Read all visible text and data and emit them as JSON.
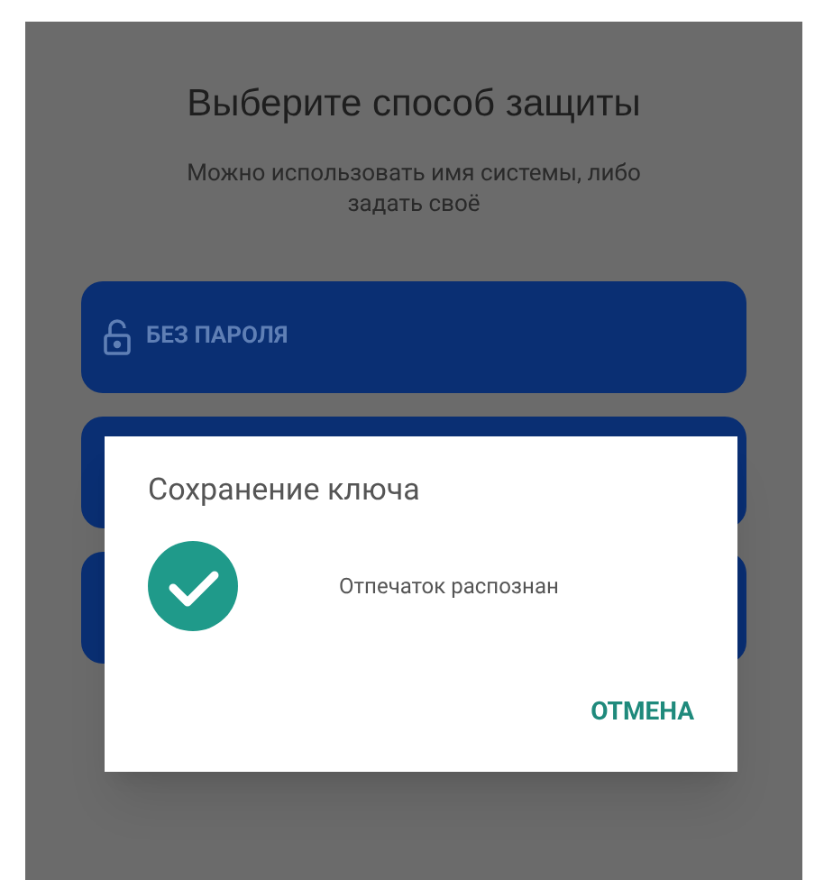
{
  "screen": {
    "title": "Выберите способ защиты",
    "subtitle": "Можно использовать имя системы, либо задать своё",
    "options": [
      {
        "label": "БЕЗ ПАРОЛЯ"
      }
    ]
  },
  "dialog": {
    "title": "Сохранение ключа",
    "status": "Отпечаток распознан",
    "buttons": [
      "ОТМЕНА"
    ]
  }
}
